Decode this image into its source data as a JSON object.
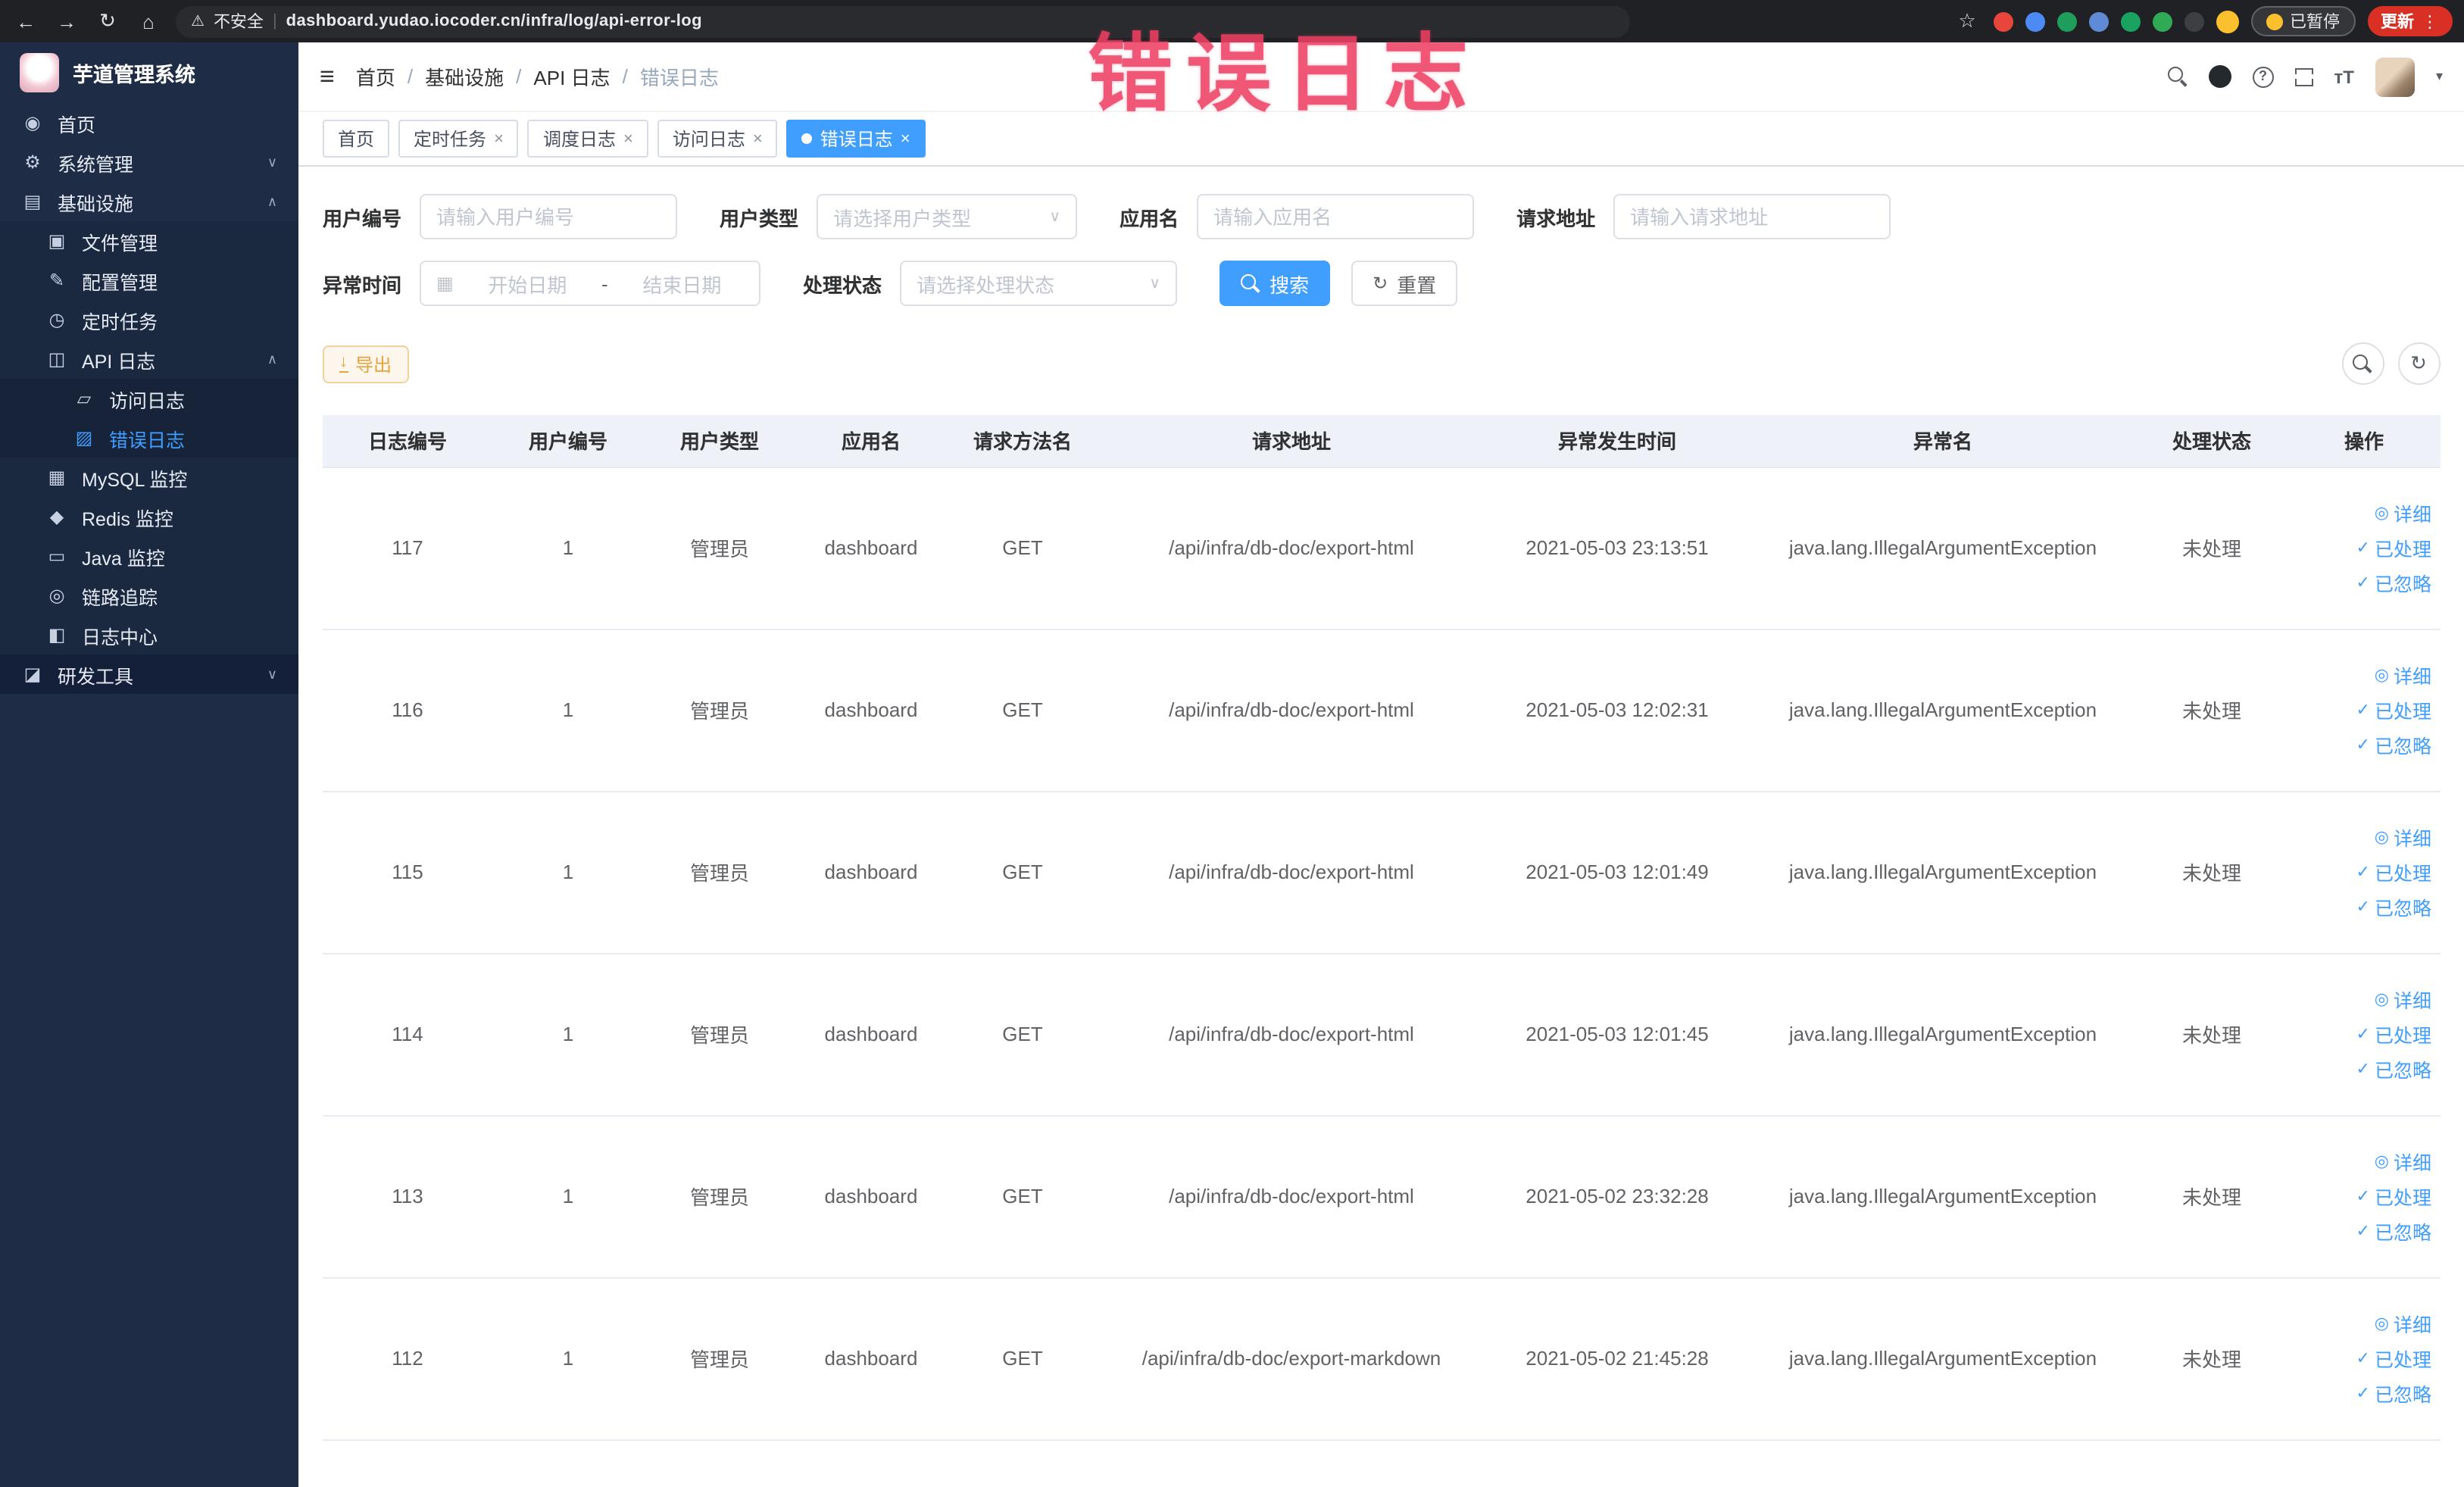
{
  "annotation": {
    "text": "错误日志",
    "color": "#ef3f62"
  },
  "browser": {
    "security_label": "不安全",
    "url_separator": "|",
    "url": "dashboard.yudao.iocoder.cn/infra/log/api-error-log",
    "paused_label": "已暂停",
    "update_label": "更新",
    "extensions": [
      {
        "name": "extension-red-shield",
        "color": "#e8453c"
      },
      {
        "name": "extension-blue-drop",
        "color": "#4c8bf5"
      },
      {
        "name": "extension-green-circle",
        "color": "#1e9e5a"
      },
      {
        "name": "extension-blue-grid",
        "color": "#5f8bd6"
      },
      {
        "name": "extension-on-badge",
        "color": "#1aa260"
      },
      {
        "name": "extension-leaf",
        "color": "#30aa55"
      },
      {
        "name": "extension-paw",
        "color": "#3c4043"
      }
    ]
  },
  "sidebar": {
    "logo_title": "芋道管理系统",
    "items": [
      {
        "label": "首页"
      },
      {
        "label": "系统管理"
      },
      {
        "label": "基础设施"
      },
      {
        "label": "文件管理"
      },
      {
        "label": "配置管理"
      },
      {
        "label": "定时任务"
      },
      {
        "label": "API 日志"
      },
      {
        "label": "访问日志"
      },
      {
        "label": "错误日志"
      },
      {
        "label": "MySQL 监控"
      },
      {
        "label": "Redis 监控"
      },
      {
        "label": "Java 监控"
      },
      {
        "label": "链路追踪"
      },
      {
        "label": "日志中心"
      },
      {
        "label": "研发工具"
      }
    ]
  },
  "header": {
    "separator": "/",
    "breadcrumb": [
      {
        "label": "首页"
      },
      {
        "label": "基础设施"
      },
      {
        "label": "API 日志"
      },
      {
        "label": "错误日志"
      }
    ]
  },
  "tabs": [
    {
      "label": "首页"
    },
    {
      "label": "定时任务"
    },
    {
      "label": "调度日志"
    },
    {
      "label": "访问日志"
    },
    {
      "label": "错误日志"
    }
  ],
  "filters": {
    "user_id": {
      "label": "用户编号",
      "placeholder": "请输入用户编号"
    },
    "user_type": {
      "label": "用户类型",
      "placeholder": "请选择用户类型"
    },
    "app_name": {
      "label": "应用名",
      "placeholder": "请输入应用名"
    },
    "request_url": {
      "label": "请求地址",
      "placeholder": "请输入请求地址"
    },
    "exception_time": {
      "label": "异常时间",
      "start_placeholder": "开始日期",
      "separator": "-",
      "end_placeholder": "结束日期"
    },
    "process_status": {
      "label": "处理状态",
      "placeholder": "请选择处理状态"
    },
    "search_label": "搜索",
    "reset_label": "重置"
  },
  "toolbar": {
    "export_label": "导出"
  },
  "table": {
    "columns": [
      "日志编号",
      "用户编号",
      "用户类型",
      "应用名",
      "请求方法名",
      "请求地址",
      "异常发生时间",
      "异常名",
      "处理状态",
      "操作"
    ],
    "actions": [
      "详细",
      "已处理",
      "已忽略"
    ],
    "rows": [
      {
        "id": "117",
        "user_id": "1",
        "user_type": "管理员",
        "app": "dashboard",
        "method": "GET",
        "url": "/api/infra/db-doc/export-html",
        "time": "2021-05-03 23:13:51",
        "exception": "java.lang.IllegalArgumentException",
        "status": "未处理"
      },
      {
        "id": "116",
        "user_id": "1",
        "user_type": "管理员",
        "app": "dashboard",
        "method": "GET",
        "url": "/api/infra/db-doc/export-html",
        "time": "2021-05-03 12:02:31",
        "exception": "java.lang.IllegalArgumentException",
        "status": "未处理"
      },
      {
        "id": "115",
        "user_id": "1",
        "user_type": "管理员",
        "app": "dashboard",
        "method": "GET",
        "url": "/api/infra/db-doc/export-html",
        "time": "2021-05-03 12:01:49",
        "exception": "java.lang.IllegalArgumentException",
        "status": "未处理"
      },
      {
        "id": "114",
        "user_id": "1",
        "user_type": "管理员",
        "app": "dashboard",
        "method": "GET",
        "url": "/api/infra/db-doc/export-html",
        "time": "2021-05-03 12:01:45",
        "exception": "java.lang.IllegalArgumentException",
        "status": "未处理"
      },
      {
        "id": "113",
        "user_id": "1",
        "user_type": "管理员",
        "app": "dashboard",
        "method": "GET",
        "url": "/api/infra/db-doc/export-html",
        "time": "2021-05-02 23:32:28",
        "exception": "java.lang.IllegalArgumentException",
        "status": "未处理"
      },
      {
        "id": "112",
        "user_id": "1",
        "user_type": "管理员",
        "app": "dashboard",
        "method": "GET",
        "url": "/api/infra/db-doc/export-markdown",
        "time": "2021-05-02 21:45:28",
        "exception": "java.lang.IllegalArgumentException",
        "status": "未处理"
      }
    ]
  },
  "icons": {
    "back": "←",
    "forward": "→",
    "reload": "↻",
    "home": "⌂",
    "warning": "⚠",
    "star": "☆",
    "kebab": "⋮",
    "hamburger": "≡",
    "chevron_down": "∨",
    "chevron_up": "∧",
    "caret_down": "▾",
    "close": "×",
    "help": "?",
    "fontsize": "тT",
    "menu_home": "◉",
    "menu_system": "⚙",
    "menu_infra": "▤",
    "menu_file": "▣",
    "menu_config": "✎",
    "menu_job": "◷",
    "menu_api": "◫",
    "menu_access": "▱",
    "menu_error": "▨",
    "menu_mysql": "▦",
    "menu_redis": "◆",
    "menu_java": "▭",
    "menu_trace": "◎",
    "menu_logcenter": "◧",
    "menu_tools": "◪",
    "export_arrow": "↓",
    "refresh": "↻",
    "calendar": "▦",
    "eye": "◎",
    "check": "✓"
  },
  "colors": {
    "accent": "#409eff",
    "active_tab": "#409eff",
    "warning": "#e6a23c",
    "update_badge": "#d93025",
    "sidebar_bg": "#1e2c45",
    "annotation": "#ef3f62"
  }
}
